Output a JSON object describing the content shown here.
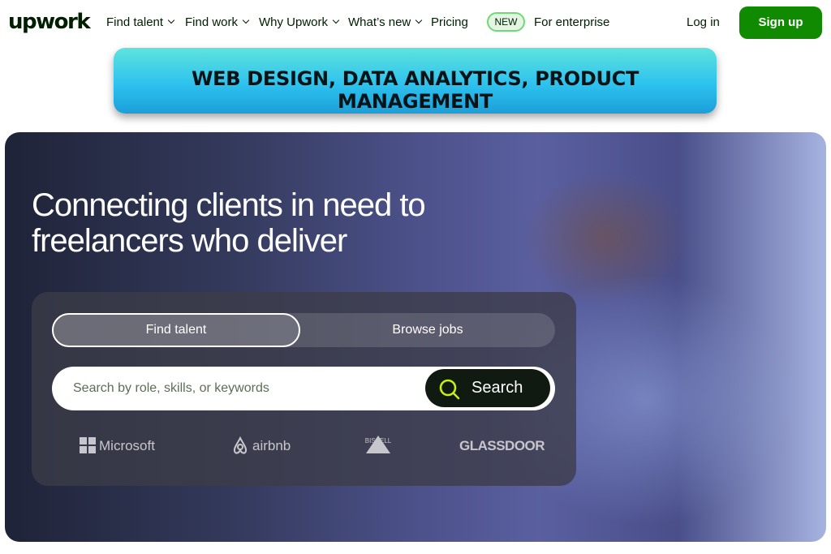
{
  "nav": {
    "logo": "upwork",
    "items": [
      "Find talent",
      "Find work",
      "Why Upwork",
      "What’s new"
    ],
    "pricing": "Pricing",
    "new_badge": "NEW",
    "enterprise": "For enterprise",
    "login": "Log in",
    "signup": "Sign up"
  },
  "banner": {
    "text": "WEB DESIGN, DATA ANALYTICS, PRODUCT MANAGEMENT"
  },
  "hero": {
    "title": "Connecting clients in need to\nfreelancers who deliver",
    "tabs": {
      "find_talent": "Find talent",
      "browse_jobs": "Browse jobs"
    },
    "search": {
      "placeholder": "Search by role, skills, or keywords",
      "button": "Search"
    },
    "clients": [
      "Microsoft",
      "airbnb",
      "BISSELL",
      "GLASSDOOR"
    ]
  },
  "colors": {
    "brand_green": "#108a00",
    "new_badge_border": "#6fda73",
    "search_button": "#111a10"
  }
}
